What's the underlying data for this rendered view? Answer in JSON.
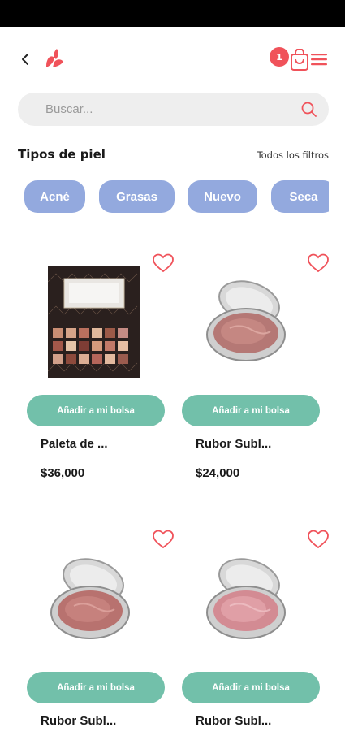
{
  "header": {
    "cart_count": "1"
  },
  "search": {
    "placeholder": "Buscar..."
  },
  "filters": {
    "title": "Tipos de piel",
    "all_label": "Todos los filtros",
    "chips": [
      "Acné",
      "Grasas",
      "Nuevo",
      "Seca"
    ]
  },
  "products": [
    {
      "name": "Paleta de ...",
      "price": "$36,000",
      "button": "Añadir a mi bolsa",
      "image": "eyeshadow-palette"
    },
    {
      "name": "Rubor Subl...",
      "price": "$24,000",
      "button": "Añadir a mi bolsa",
      "image": "blush-compact"
    },
    {
      "name": "Rubor Subl...",
      "price": "",
      "button": "Añadir a mi bolsa",
      "image": "blush-compact"
    },
    {
      "name": "Rubor Subl...",
      "price": "",
      "button": "Añadir a mi bolsa",
      "image": "blush-compact"
    }
  ],
  "colors": {
    "accent": "#f0525a",
    "chip": "#93a9de",
    "button": "#72c0aa"
  }
}
